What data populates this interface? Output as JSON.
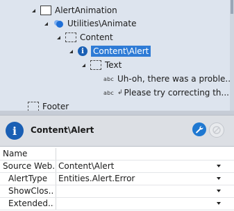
{
  "tree": {
    "nodes": [
      {
        "label": "AlertAnimation"
      },
      {
        "label": "Utilities\\Animate"
      },
      {
        "label": "Content"
      },
      {
        "label": "Content\\Alert"
      },
      {
        "label": "Text"
      },
      {
        "label": "Uh-oh, there was a proble..."
      },
      {
        "label": "Please try correcting th..."
      },
      {
        "label": "Footer"
      }
    ],
    "text_badge": "abc",
    "info_glyph": "i"
  },
  "header": {
    "title": "Content\\Alert",
    "info_glyph": "i"
  },
  "properties": {
    "rows": [
      {
        "name": "Name",
        "value": ""
      },
      {
        "name": "Source Web...",
        "value": "Content\\Alert"
      },
      {
        "name": "AlertType",
        "value": "Entities.Alert.Error"
      },
      {
        "name": "ShowClos...",
        "value": ""
      },
      {
        "name": "Extended...",
        "value": ""
      }
    ]
  },
  "colors": {
    "selection": "#2e7bd6",
    "tree_background": "#dde4ee",
    "info_icon": "#1a5fb4"
  }
}
